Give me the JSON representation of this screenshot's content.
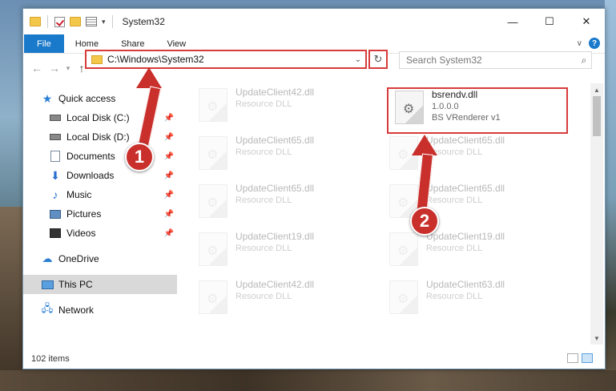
{
  "window": {
    "title": "System32",
    "controls": {
      "minimize": "—",
      "maximize": "☐",
      "close": "✕"
    }
  },
  "ribbon": {
    "tabs": [
      "File",
      "Home",
      "Share",
      "View"
    ]
  },
  "navigation": {
    "address": "C:\\Windows\\System32",
    "search_placeholder": "Search System32"
  },
  "sidebar": {
    "quick_access": "Quick access",
    "items": [
      {
        "label": "Local Disk (C:)",
        "icon": "drive-icon"
      },
      {
        "label": "Local Disk (D:)",
        "icon": "drive-icon"
      },
      {
        "label": "Documents",
        "icon": "documents-icon"
      },
      {
        "label": "Downloads",
        "icon": "downloads-icon"
      },
      {
        "label": "Music",
        "icon": "music-icon"
      },
      {
        "label": "Pictures",
        "icon": "pictures-icon"
      },
      {
        "label": "Videos",
        "icon": "videos-icon"
      }
    ],
    "onedrive": "OneDrive",
    "this_pc": "This PC",
    "network": "Network"
  },
  "files": {
    "left": [
      {
        "name": "UpdateClient42.dll",
        "type": "Resource DLL"
      },
      {
        "name": "UpdateClient65.dll",
        "type": "Resource DLL"
      },
      {
        "name": "UpdateClient65.dll",
        "type": "Resource DLL"
      },
      {
        "name": "UpdateClient19.dll",
        "type": "Resource DLL"
      },
      {
        "name": "UpdateClient42.dll",
        "type": "Resource DLL"
      }
    ],
    "highlighted": {
      "name": "bsrendv.dll",
      "version": "1.0.0.0",
      "description": "BS VRenderer v1"
    },
    "right": [
      {
        "name": "UpdateClient65.dll",
        "type": "Resource DLL"
      },
      {
        "name": "UpdateClient65.dll",
        "type": "Resource DLL"
      },
      {
        "name": "UpdateClient19.dll",
        "type": "Resource DLL"
      },
      {
        "name": "UpdateClient63.dll",
        "type": "Resource DLL"
      }
    ]
  },
  "status": {
    "item_count": "102 items"
  },
  "annotations": {
    "step1": "1",
    "step2": "2",
    "color": "#c9302c"
  }
}
